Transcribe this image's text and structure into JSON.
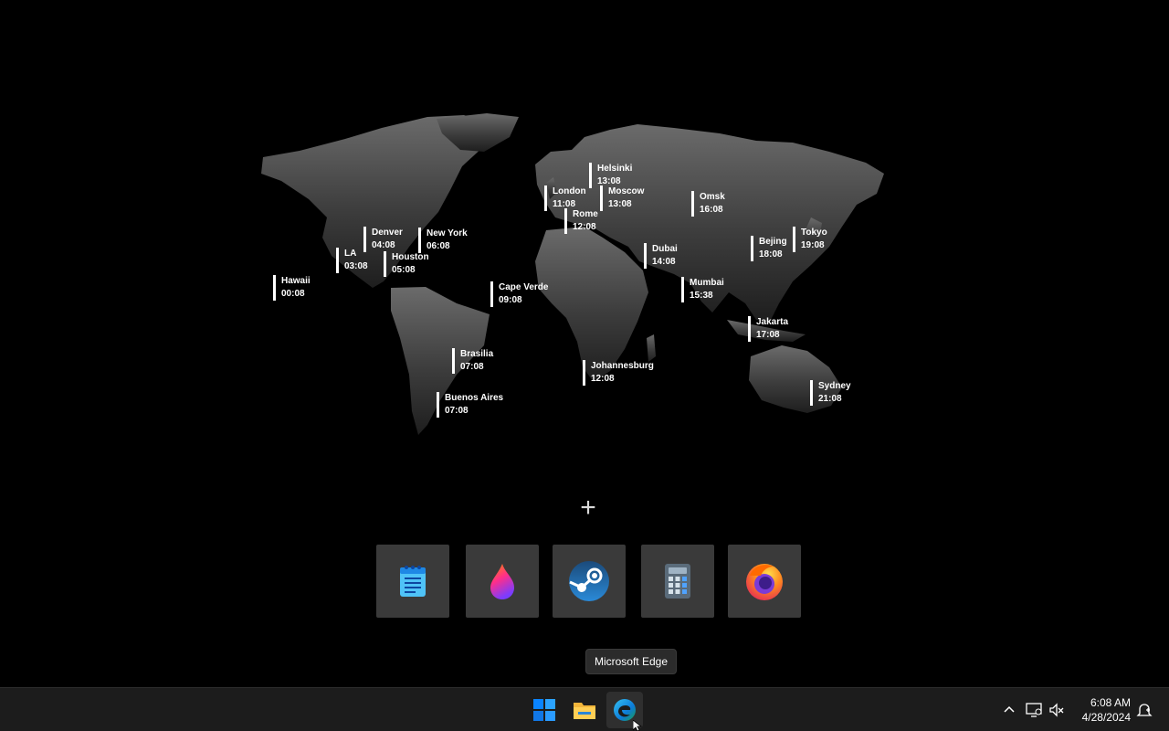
{
  "world_clock": {
    "cities": [
      {
        "id": "hawaii",
        "name": "Hawaii",
        "time": "00:08"
      },
      {
        "id": "la",
        "name": "LA",
        "time": "03:08"
      },
      {
        "id": "denver",
        "name": "Denver",
        "time": "04:08"
      },
      {
        "id": "houston",
        "name": "Houston",
        "time": "05:08"
      },
      {
        "id": "new-york",
        "name": "New York",
        "time": "06:08"
      },
      {
        "id": "cape-verde",
        "name": "Cape Verde",
        "time": "09:08"
      },
      {
        "id": "brasilia",
        "name": "Brasilia",
        "time": "07:08"
      },
      {
        "id": "buenos-aires",
        "name": "Buenos Aires",
        "time": "07:08"
      },
      {
        "id": "london",
        "name": "London",
        "time": "11:08"
      },
      {
        "id": "helsinki",
        "name": "Helsinki",
        "time": "13:08"
      },
      {
        "id": "moscow",
        "name": "Moscow",
        "time": "13:08"
      },
      {
        "id": "rome",
        "name": "Rome",
        "time": "12:08"
      },
      {
        "id": "dubai",
        "name": "Dubai",
        "time": "14:08"
      },
      {
        "id": "johannesburg",
        "name": "Johannesburg",
        "time": "12:08"
      },
      {
        "id": "omsk",
        "name": "Omsk",
        "time": "16:08"
      },
      {
        "id": "mumbai",
        "name": "Mumbai",
        "time": "15:38"
      },
      {
        "id": "bejing",
        "name": "Bejing",
        "time": "18:08"
      },
      {
        "id": "tokyo",
        "name": "Tokyo",
        "time": "19:08"
      },
      {
        "id": "jakarta",
        "name": "Jakarta",
        "time": "17:08"
      },
      {
        "id": "sydney",
        "name": "Sydney",
        "time": "21:08"
      }
    ]
  },
  "launcher": {
    "add_icon": "plus-icon",
    "apps": [
      {
        "id": "notepad",
        "icon": "notepad-icon"
      },
      {
        "id": "flame-app",
        "icon": "flame-icon"
      },
      {
        "id": "steam",
        "icon": "steam-icon"
      },
      {
        "id": "calculator",
        "icon": "calculator-icon"
      },
      {
        "id": "firefox",
        "icon": "firefox-icon"
      }
    ]
  },
  "tooltip": {
    "text": "Microsoft Edge"
  },
  "taskbar": {
    "pinned": [
      {
        "id": "start",
        "icon": "windows-start-icon"
      },
      {
        "id": "file-explorer",
        "icon": "folder-icon"
      },
      {
        "id": "edge",
        "icon": "edge-icon",
        "active": true
      }
    ],
    "tray": {
      "icons": [
        "chevron-up-icon",
        "network-icon",
        "volume-muted-icon",
        "notification-icon"
      ],
      "time": "6:08 AM",
      "date": "4/28/2024"
    }
  },
  "colors": {
    "background": "#000000",
    "taskbar": "#1c1c1c",
    "tile": "#3a3a3a",
    "accent": "#0078d4"
  }
}
